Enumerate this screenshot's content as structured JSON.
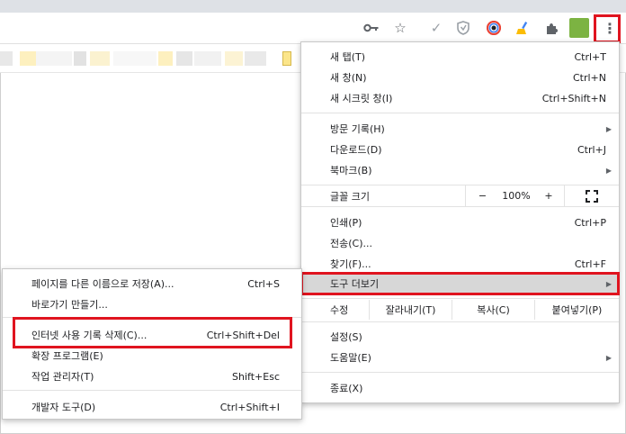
{
  "toolbar": {
    "icons": [
      "key-icon",
      "star-icon",
      "check-extension-icon",
      "shield-extension-icon",
      "color-wheel-extension-icon",
      "broom-extension-icon",
      "puzzle-icon",
      "profile-avatar",
      "more-vertical-icon"
    ],
    "colors": {
      "accent_highlight": "#e0141f",
      "menu_hover": "#d7d7d7"
    }
  },
  "menu": {
    "new_tab": {
      "label": "새 탭(T)",
      "shortcut": "Ctrl+T"
    },
    "new_window": {
      "label": "새 창(N)",
      "shortcut": "Ctrl+N"
    },
    "new_incognito": {
      "label": "새 시크릿 창(I)",
      "shortcut": "Ctrl+Shift+N"
    },
    "history": {
      "label": "방문 기록(H)"
    },
    "downloads": {
      "label": "다운로드(D)",
      "shortcut": "Ctrl+J"
    },
    "bookmarks": {
      "label": "북마크(B)"
    },
    "zoom": {
      "label": "글꼴 크기",
      "minus": "−",
      "value": "100%",
      "plus": "+"
    },
    "print": {
      "label": "인쇄(P)",
      "shortcut": "Ctrl+P"
    },
    "cast": {
      "label": "전송(C)..."
    },
    "find": {
      "label": "찾기(F)...",
      "shortcut": "Ctrl+F"
    },
    "more_tools": {
      "label": "도구 더보기"
    },
    "edit": {
      "label": "수정",
      "cut": "잘라내기(T)",
      "copy": "복사(C)",
      "paste": "붙여넣기(P)"
    },
    "settings": {
      "label": "설정(S)"
    },
    "help": {
      "label": "도움말(E)"
    },
    "exit": {
      "label": "종료(X)"
    }
  },
  "submenu": {
    "save_page": {
      "label": "페이지를 다른 이름으로 저장(A)...",
      "shortcut": "Ctrl+S"
    },
    "create_shortcut": {
      "label": "바로가기 만들기..."
    },
    "clear_data": {
      "label": "인터넷 사용 기록 삭제(C)...",
      "shortcut": "Ctrl+Shift+Del"
    },
    "extensions": {
      "label": "확장 프로그램(E)"
    },
    "task_manager": {
      "label": "작업 관리자(T)",
      "shortcut": "Shift+Esc"
    },
    "dev_tools": {
      "label": "개발자 도구(D)",
      "shortcut": "Ctrl+Shift+I"
    }
  }
}
